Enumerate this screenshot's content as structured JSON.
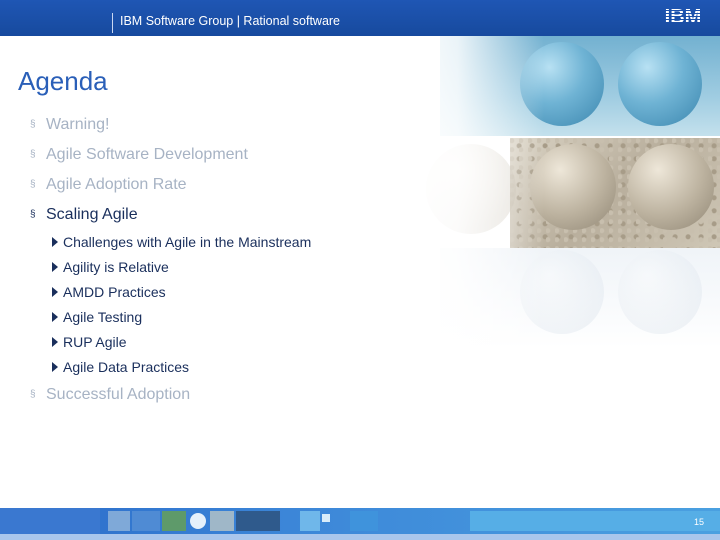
{
  "header": {
    "group_title": "IBM Software Group | Rational software",
    "logo_text": "IBM",
    "logo_color": "#ffffff",
    "bar_color": "#1f56b4"
  },
  "slide": {
    "title": "Agenda",
    "title_color": "#2a5fb8",
    "items": [
      {
        "label": "Warning!",
        "active": false
      },
      {
        "label": "Agile Software Development",
        "active": false
      },
      {
        "label": "Agile Adoption Rate",
        "active": false
      },
      {
        "label": "Scaling Agile",
        "active": true,
        "subitems": [
          "Challenges with Agile in the Mainstream",
          "Agility is Relative",
          "AMDD Practices",
          "Agile Testing",
          "RUP Agile",
          "Agile Data Practices"
        ]
      },
      {
        "label": "Successful Adoption",
        "active": false
      }
    ],
    "bullet_glyph": "§",
    "sub_bullet_icon": "triangle-right-icon",
    "active_color": "#1a2f5c",
    "inactive_color": "#a7b3c4"
  },
  "footer": {
    "page_number": "15",
    "band_color": "#2a6ac8"
  }
}
